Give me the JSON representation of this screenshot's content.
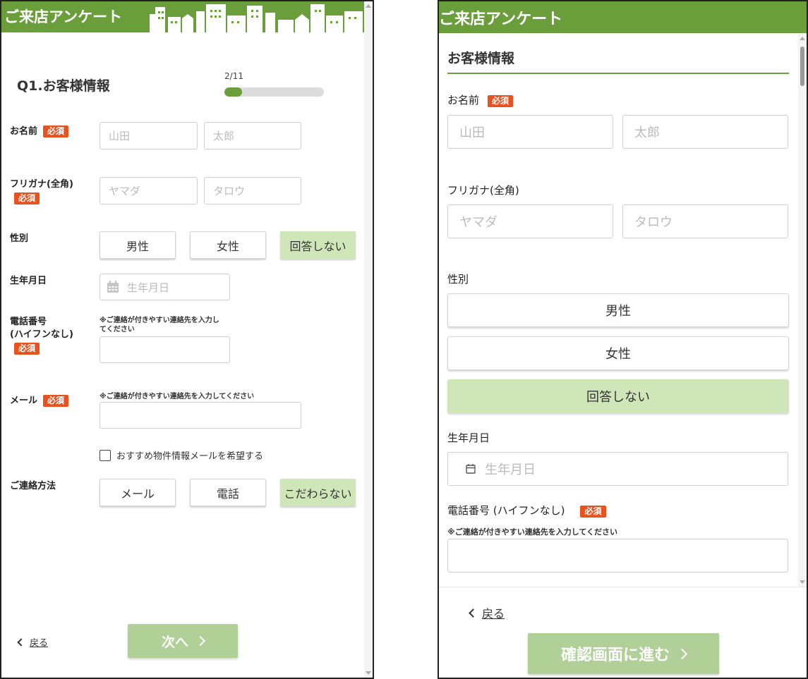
{
  "colors": {
    "header_green": "#6a9e3a",
    "selected_green": "#cfe6b8",
    "required_orange": "#e8521f",
    "next_green": "#b0d098"
  },
  "left": {
    "header_title": "ご来店アンケート",
    "question_title": "Q1.お客様情報",
    "progress": {
      "label": "2/11",
      "fraction": 0.18
    },
    "required_badge": "必須",
    "name": {
      "label": "お名前",
      "last_placeholder": "山田",
      "first_placeholder": "太郎"
    },
    "kana": {
      "label": "フリガナ(全角)",
      "last_placeholder": "ヤマダ",
      "first_placeholder": "タロウ"
    },
    "gender": {
      "label": "性別",
      "options": [
        "男性",
        "女性",
        "回答しない"
      ],
      "selected": "回答しない"
    },
    "birthday": {
      "label": "生年月日",
      "placeholder": "生年月日",
      "icon": "calendar-icon"
    },
    "phone": {
      "label_line1": "電話番号",
      "label_line2": "(ハイフンなし)",
      "note_line1": "※ご連絡が付きやすい連絡先を入力し",
      "note_line2": "てください"
    },
    "email": {
      "label": "メール",
      "note": "※ご連絡が付きやすい連絡先を入力してください"
    },
    "newsletter": {
      "label": "おすすめ物件情報メールを希望する",
      "checked": false
    },
    "contact": {
      "label": "ご連絡方法",
      "options": [
        "メール",
        "電話",
        "こだわらない"
      ],
      "selected": "こだわらない"
    },
    "back_label": "戻る",
    "next_label": "次へ"
  },
  "right": {
    "header_title": "ご来店アンケート",
    "section_title": "お客様情報",
    "required_badge": "必須",
    "name": {
      "label": "お名前",
      "last_placeholder": "山田",
      "first_placeholder": "太郎"
    },
    "kana": {
      "label": "フリガナ(全角)",
      "last_placeholder": "ヤマダ",
      "first_placeholder": "タロウ"
    },
    "gender": {
      "label": "性別",
      "options": [
        "男性",
        "女性",
        "回答しない"
      ],
      "selected": "回答しない"
    },
    "birthday": {
      "label": "生年月日",
      "placeholder": "生年月日",
      "icon": "calendar-icon"
    },
    "phone": {
      "label": "電話番号 (ハイフンなし)",
      "note": "※ご連絡が付きやすい連絡先を入力してください"
    },
    "back_label": "戻る",
    "confirm_label": "確認画面に進む"
  }
}
